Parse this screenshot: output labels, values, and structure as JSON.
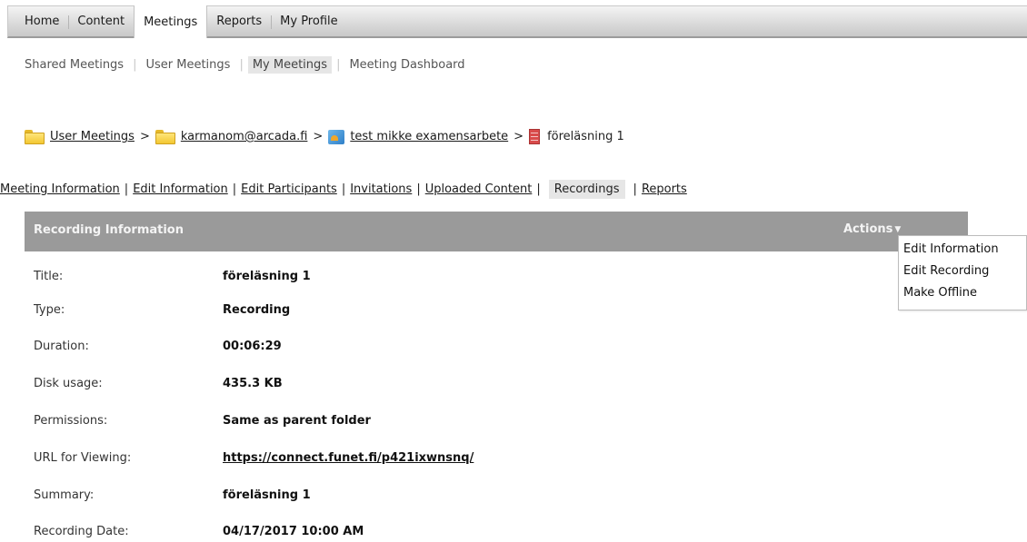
{
  "topnav": {
    "items": [
      "Home",
      "Content",
      "Meetings",
      "Reports",
      "My Profile"
    ],
    "active": "Meetings"
  },
  "subnav": {
    "items": [
      "Shared Meetings",
      "User Meetings",
      "My Meetings",
      "Meeting Dashboard"
    ],
    "active": "My Meetings"
  },
  "breadcrumb": {
    "items": [
      {
        "label": "User Meetings",
        "icon": "folder-icon"
      },
      {
        "label": "karmanom@arcada.fi",
        "icon": "folder-icon"
      },
      {
        "label": "test mikke examensarbete",
        "icon": "meeting-icon"
      },
      {
        "label": "föreläsning 1",
        "icon": "recording-icon"
      }
    ],
    "separator": ">"
  },
  "section_tabs": {
    "items": [
      "Meeting Information",
      "Edit Information",
      "Edit Participants",
      "Invitations",
      "Uploaded Content",
      "Recordings",
      "Reports"
    ],
    "active": "Recordings"
  },
  "panel": {
    "title": "Recording Information",
    "actions_label": "Actions"
  },
  "actions_menu": {
    "items": [
      "Edit Information",
      "Edit Recording",
      "Make Offline"
    ]
  },
  "details": [
    {
      "label": "Title:",
      "value": "föreläsning 1"
    },
    {
      "label": "Type:",
      "value": "Recording"
    },
    {
      "label": "Duration:",
      "value": "00:06:29"
    },
    {
      "label": "Disk usage:",
      "value": "435.3 KB"
    },
    {
      "label": "Permissions:",
      "value": "Same as parent folder"
    },
    {
      "label": "URL for Viewing:",
      "value": "https://connect.funet.fi/p421ixwnsnq/"
    },
    {
      "label": "Summary:",
      "value": "föreläsning 1"
    },
    {
      "label": "Recording Date:",
      "value": "04/17/2017 10:00 AM"
    }
  ],
  "colors": {
    "panel_header": "#9a9a9a",
    "active_tab_bg": "#e6e6e6"
  }
}
